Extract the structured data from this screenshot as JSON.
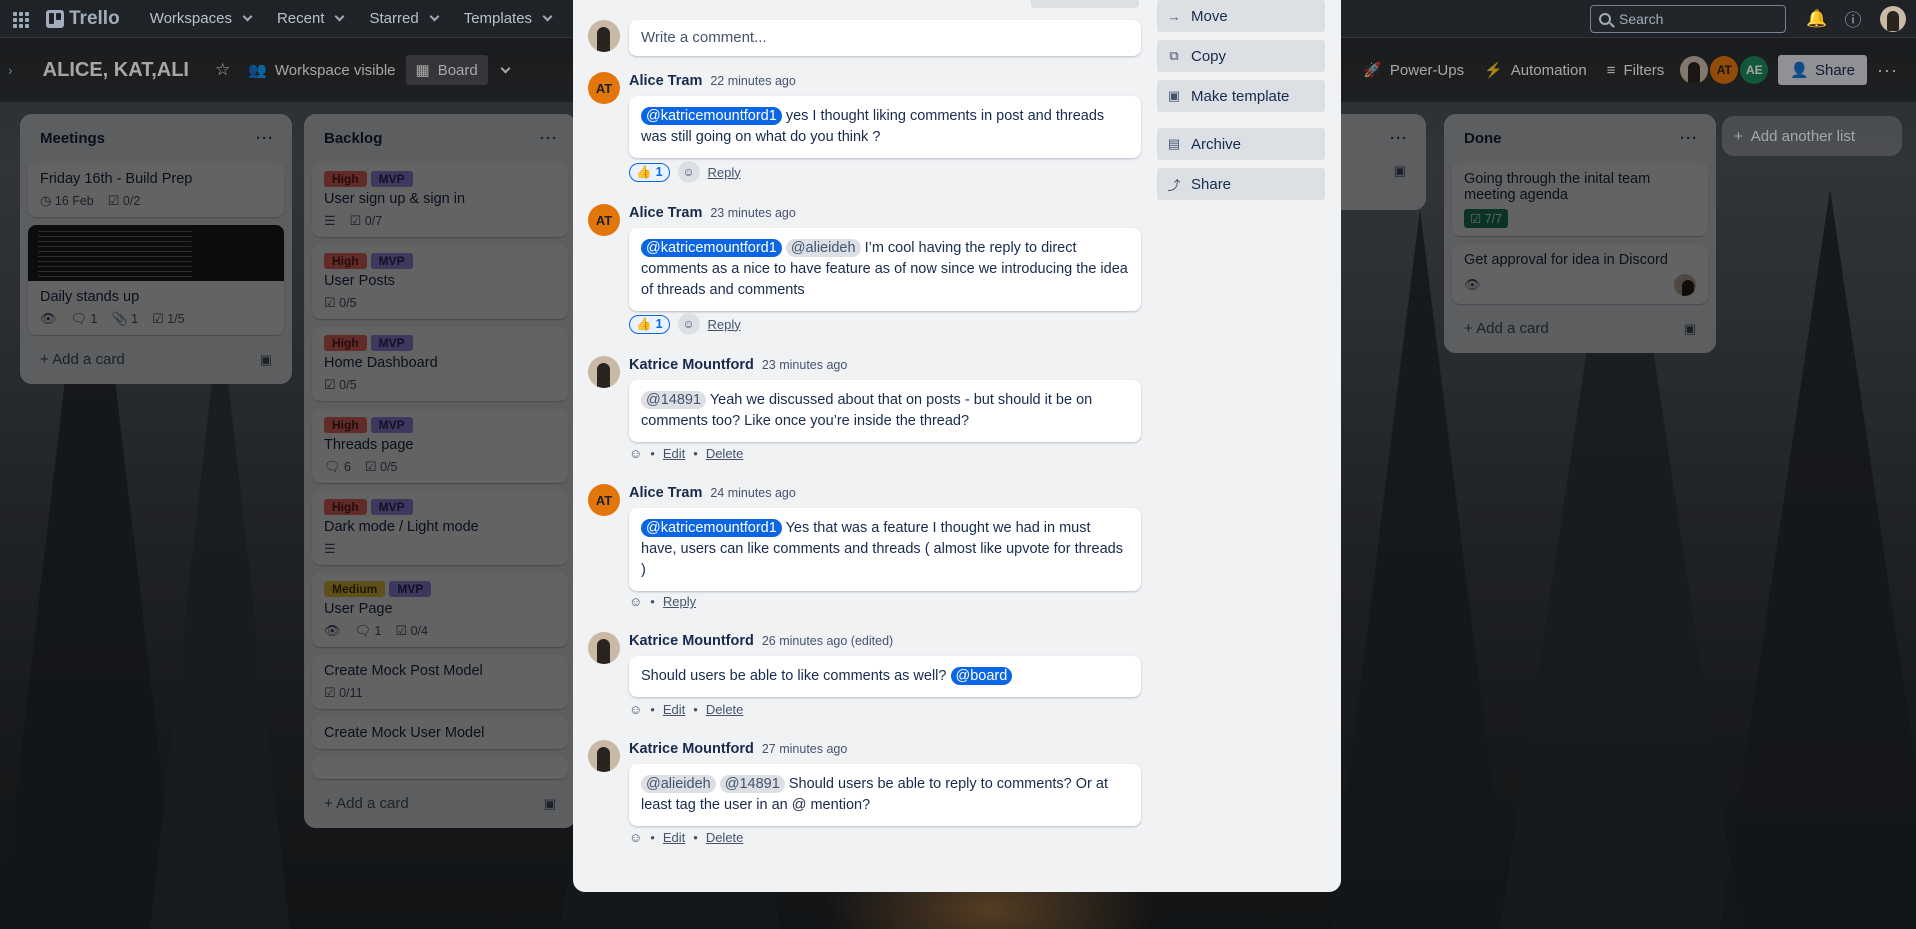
{
  "nav": {
    "workspaces": "Workspaces",
    "recent": "Recent",
    "starred": "Starred",
    "templates": "Templates",
    "logo": "Trello",
    "search_placeholder": "Search"
  },
  "board": {
    "title": "ALICE, KAT,ALI",
    "visibility": "Workspace visible",
    "view": "Board",
    "power_ups": "Power-Ups",
    "automation": "Automation",
    "filters": "Filters",
    "share": "Share",
    "add_list": "Add another list",
    "members": [
      "AT",
      "AE"
    ]
  },
  "lists": {
    "meetings": {
      "title": "Meetings",
      "cards": [
        {
          "title": "Friday 16th - Build Prep",
          "date": "16 Feb",
          "checklist": "0/2"
        },
        {
          "title": "Daily stands up",
          "comments": "1",
          "attachments": "1",
          "checklist": "1/5"
        }
      ],
      "add": "Add a card"
    },
    "backlog": {
      "title": "Backlog",
      "cards": [
        {
          "priority": "High",
          "tag": "MVP",
          "title": "User sign up & sign in",
          "checklist": "0/7"
        },
        {
          "priority": "High",
          "tag": "MVP",
          "title": "User Posts",
          "checklist": "0/5"
        },
        {
          "priority": "High",
          "tag": "MVP",
          "title": "Home Dashboard",
          "checklist": "0/5"
        },
        {
          "priority": "High",
          "tag": "MVP",
          "title": "Threads page",
          "comments": "6",
          "checklist": "0/5"
        },
        {
          "priority": "High",
          "tag": "MVP",
          "title": "Dark mode / Light mode"
        },
        {
          "priority": "Medium",
          "tag": "MVP",
          "title": "User Page",
          "comments": "1",
          "checklist": "0/4"
        },
        {
          "title": "Create Mock Post Model",
          "checklist": "0/11"
        },
        {
          "title": "Create Mock User Model"
        }
      ],
      "add": "Add a card"
    },
    "done": {
      "title": "Done",
      "cards": [
        {
          "title": "Going through the inital team meeting agenda",
          "checklist": "7/7"
        },
        {
          "title": "Get approval for idea in Discord"
        }
      ],
      "add": "Add a card"
    }
  },
  "modal": {
    "comment_placeholder": "Write a comment...",
    "actions": {
      "move": "Move",
      "copy": "Copy",
      "make_template": "Make template",
      "archive": "Archive",
      "share": "Share"
    },
    "labels": {
      "reply": "Reply",
      "edit": "Edit",
      "delete": "Delete",
      "dot": "•"
    },
    "comments": [
      {
        "author": "Alice Tram",
        "time": "22 minutes ago",
        "mentions": [
          "@katricemountford1"
        ],
        "text": "yes I thought liking comments in post and threads was still going on what do you think ?",
        "likes": "1"
      },
      {
        "author": "Alice Tram",
        "time": "23 minutes ago",
        "mentions": [
          "@katricemountford1",
          "@alieideh"
        ],
        "text": "I’m cool having the reply to direct comments as a nice to have feature as of now since we introducing the idea of threads and comments",
        "likes": "1"
      },
      {
        "author": "Katrice Mountford",
        "time": "23 minutes ago",
        "mentions": [
          "@14891"
        ],
        "text": "Yeah we discussed about that on posts - but should it be on comments too? Like once you’re inside the thread?"
      },
      {
        "author": "Alice Tram",
        "time": "24 minutes ago",
        "mentions": [
          "@katricemountford1"
        ],
        "text": "Yes that was a feature I thought we had in must have, users can like comments and threads ( almost like upvote for threads )"
      },
      {
        "author": "Katrice Mountford",
        "time": "26 minutes ago (edited)",
        "text": "Should users be able to like comments as well?",
        "mention_after": "@board"
      },
      {
        "author": "Katrice Mountford",
        "time": "27 minutes ago",
        "mentions": [
          "@alieideh",
          "@14891"
        ],
        "text": "Should users be able to reply to comments? Or at least tag the user in an @ mention?"
      }
    ]
  },
  "colors": {
    "mention_blue": "#0c66e4",
    "label_high": "#f87168",
    "label_mvp": "#9f8fef",
    "label_medium": "#f5cd47",
    "avatar_at": "#e2760b",
    "avatar_ae": "#1f845a"
  }
}
